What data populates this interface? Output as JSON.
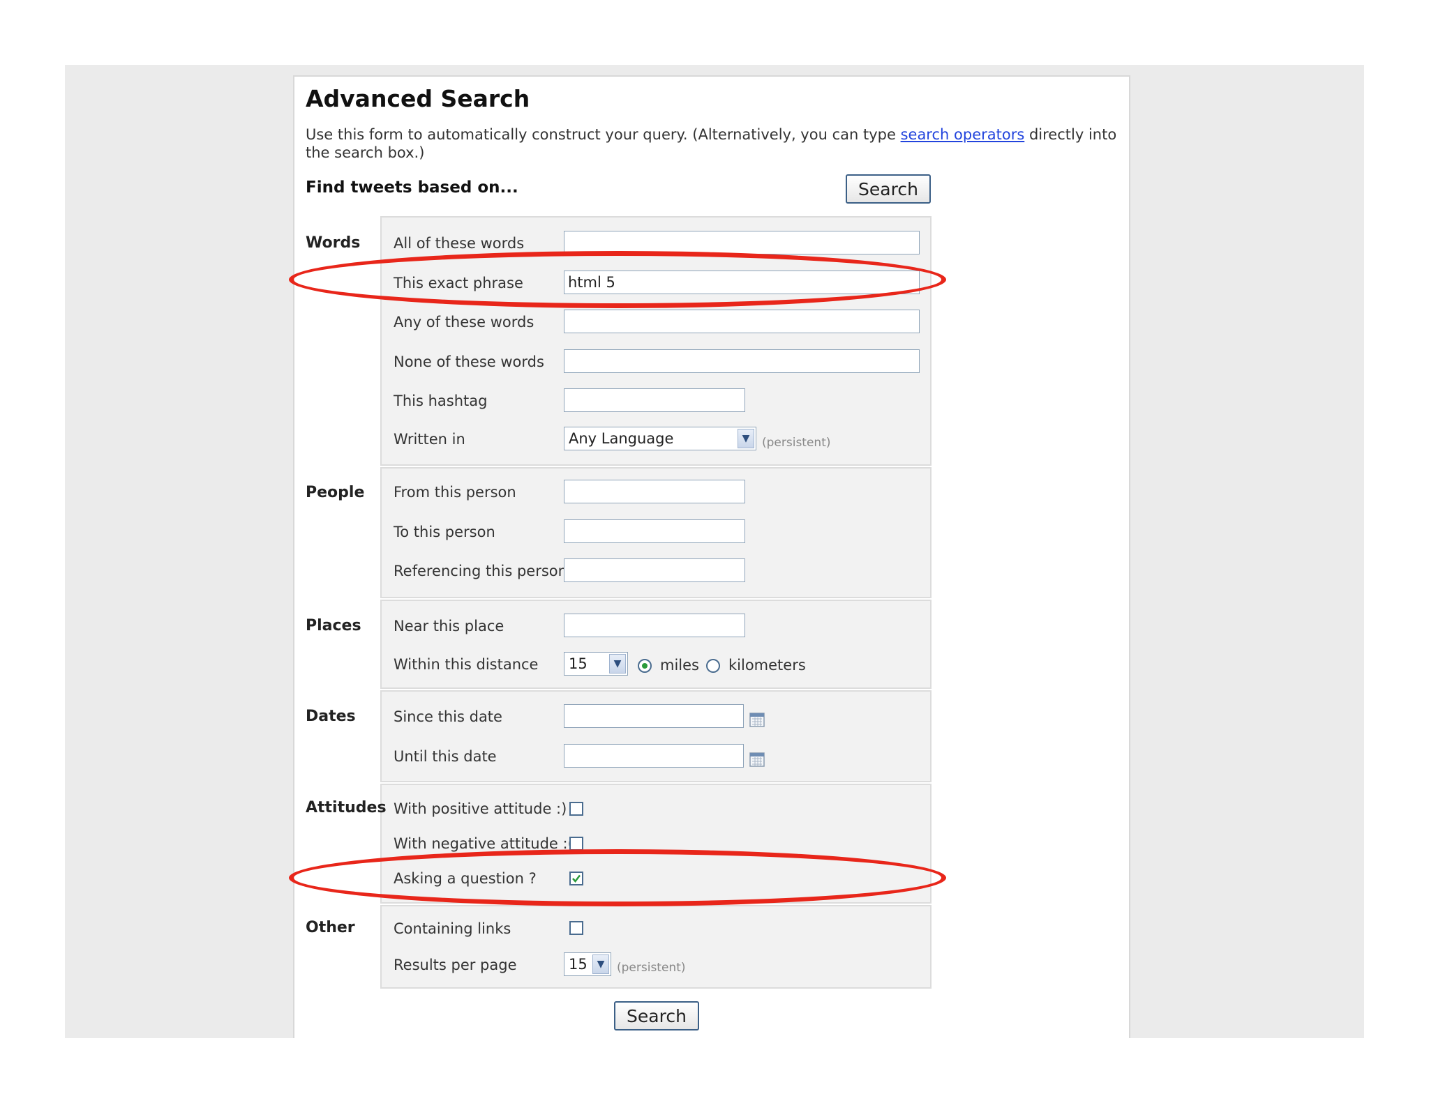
{
  "page": {
    "title": "Advanced Search",
    "intro_before": "Use this form to automatically construct your query. (Alternatively, you can type",
    "intro_link": "search operators",
    "intro_after": "directly into the search box.)",
    "find_heading": "Find tweets based on...",
    "search_button": "Search",
    "search_button_bottom": "Search"
  },
  "sections": {
    "words": {
      "label": "Words",
      "all_label": "All of these words",
      "all_value": "",
      "exact_label": "This exact phrase",
      "exact_value": "html 5",
      "any_label": "Any of these words",
      "any_value": "",
      "none_label": "None of these words",
      "none_value": "",
      "hashtag_label": "This hashtag",
      "hashtag_value": "",
      "lang_label": "Written in",
      "lang_value": "Any Language",
      "lang_hint": "(persistent)"
    },
    "people": {
      "label": "People",
      "from_label": "From this person",
      "to_label": "To this person",
      "ref_label": "Referencing this person"
    },
    "places": {
      "label": "Places",
      "near_label": "Near this place",
      "distance_label": "Within this distance",
      "distance_value": "15",
      "miles_label": "miles",
      "km_label": "kilometers",
      "unit_selected": "miles"
    },
    "dates": {
      "label": "Dates",
      "since_label": "Since this date",
      "until_label": "Until this date"
    },
    "attitudes": {
      "label": "Attitudes",
      "positive_label": "With positive attitude :)",
      "positive_checked": false,
      "negative_label": "With negative attitude :(",
      "negative_checked": false,
      "question_label": "Asking a question ?",
      "question_checked": true
    },
    "other": {
      "label": "Other",
      "links_label": "Containing links",
      "links_checked": false,
      "rpp_label": "Results per page",
      "rpp_value": "15",
      "rpp_hint": "(persistent)"
    }
  },
  "colors": {
    "highlight": "#e8261a",
    "link": "#2244dd",
    "check": "#2a9a3a"
  }
}
